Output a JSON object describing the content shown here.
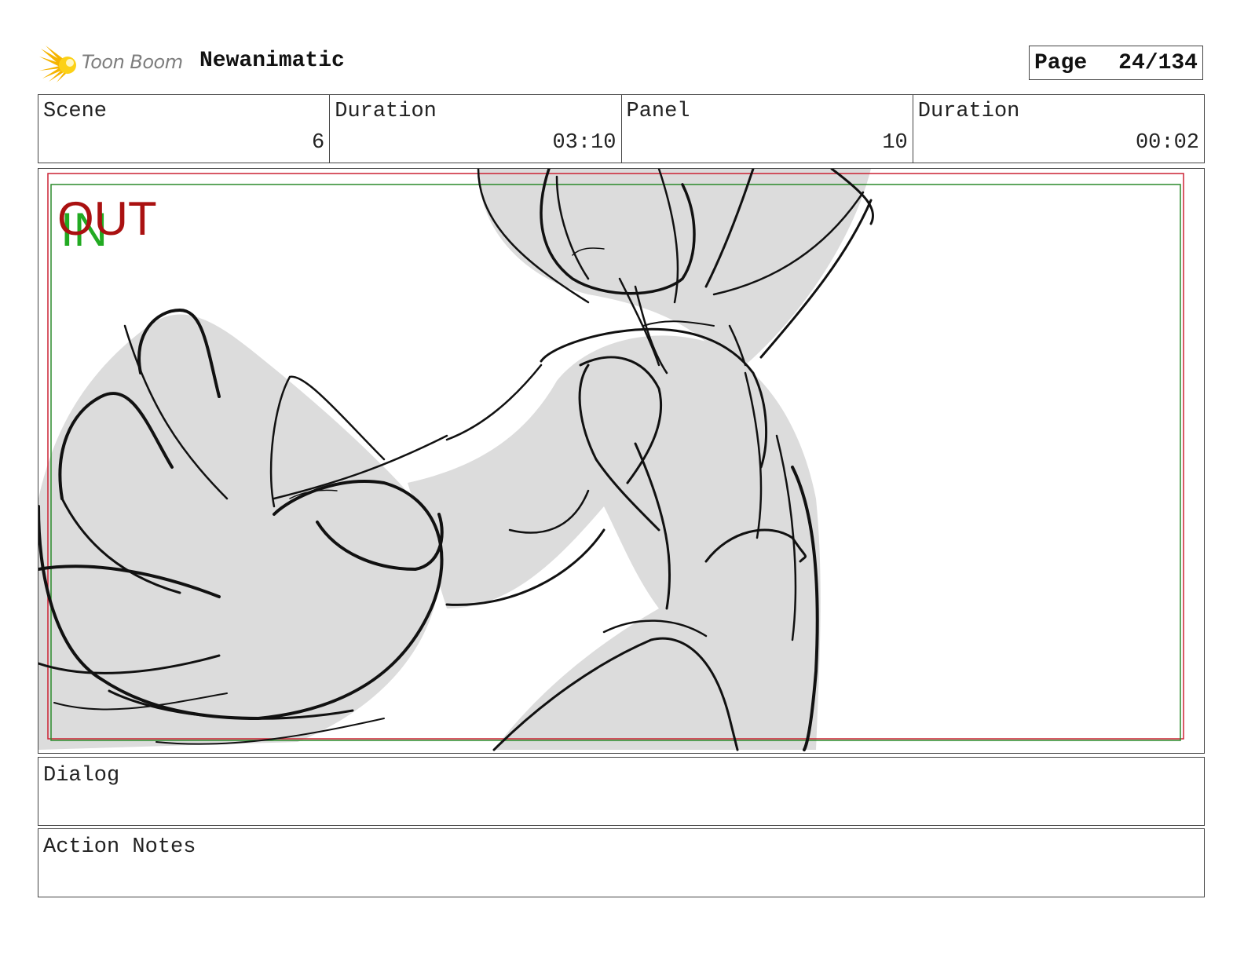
{
  "header": {
    "brand": "Toon Boom",
    "project_title": "Newanimatic",
    "page_label": "Page",
    "page_value": "24/134"
  },
  "info": {
    "scene_label": "Scene",
    "scene_value": "6",
    "scene_duration_label": "Duration",
    "scene_duration_value": "03:10",
    "panel_label": "Panel",
    "panel_value": "10",
    "panel_duration_label": "Duration",
    "panel_duration_value": "00:02"
  },
  "panel": {
    "in_marker": "IN",
    "out_marker": "OUT",
    "in_color": "#22aa22",
    "out_color": "#aa1111"
  },
  "dialog": {
    "label": "Dialog"
  },
  "action_notes": {
    "label": "Action Notes"
  }
}
